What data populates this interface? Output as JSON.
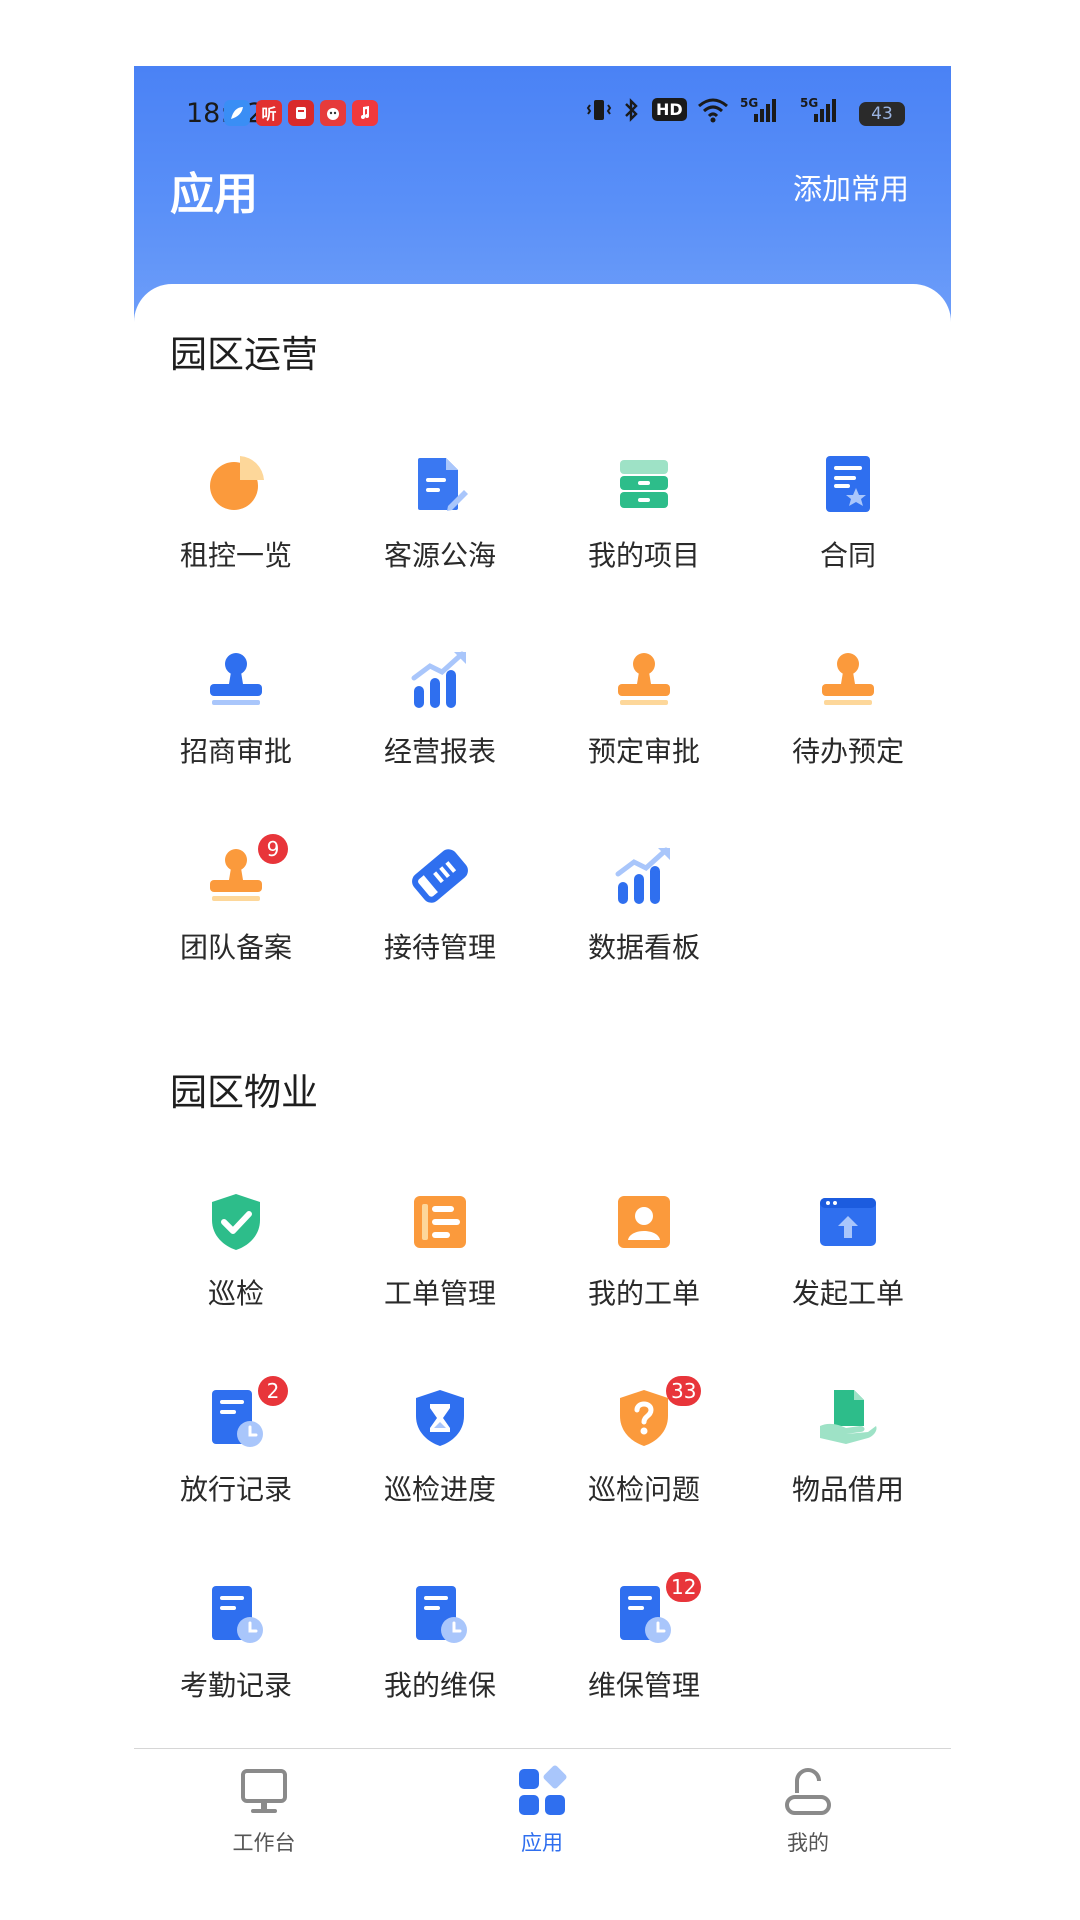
{
  "status_bar": {
    "time": "18:52",
    "notification_icons": [
      "feather-app-icon",
      "ting-app-icon",
      "news-app-icon",
      "mascot-app-icon",
      "music-app-icon"
    ],
    "ting_label": "听",
    "system_icons": [
      "vibrate-icon",
      "bluetooth-icon",
      "hd-icon",
      "wifi-icon",
      "5g-signal-icon",
      "5g-signal-icon"
    ],
    "hd_label": "HD",
    "signal_label": "5G",
    "battery": "43"
  },
  "header": {
    "title": "应用",
    "add_common": "添加常用"
  },
  "sections": [
    {
      "title": "园区运营",
      "apps": [
        {
          "label": "租控一览",
          "icon": "pie-chart-icon"
        },
        {
          "label": "客源公海",
          "icon": "edit-document-icon"
        },
        {
          "label": "我的项目",
          "icon": "archive-box-icon"
        },
        {
          "label": "合同",
          "icon": "contract-star-icon"
        },
        {
          "label": "招商审批",
          "icon": "stamp-blue-icon"
        },
        {
          "label": "经营报表",
          "icon": "bar-chart-trend-icon"
        },
        {
          "label": "预定审批",
          "icon": "stamp-orange-icon"
        },
        {
          "label": "待办预定",
          "icon": "stamp-orange-icon"
        },
        {
          "label": "团队备案",
          "icon": "stamp-orange-icon",
          "badge": "9"
        },
        {
          "label": "接待管理",
          "icon": "ticket-icon"
        },
        {
          "label": "数据看板",
          "icon": "bar-chart-trend-icon"
        }
      ]
    },
    {
      "title": "园区物业",
      "apps": [
        {
          "label": "巡检",
          "icon": "shield-check-icon"
        },
        {
          "label": "工单管理",
          "icon": "work-order-icon"
        },
        {
          "label": "我的工单",
          "icon": "user-card-icon"
        },
        {
          "label": "发起工单",
          "icon": "browser-upload-icon"
        },
        {
          "label": "放行记录",
          "icon": "document-clock-icon",
          "badge": "2"
        },
        {
          "label": "巡检进度",
          "icon": "shield-hourglass-icon"
        },
        {
          "label": "巡检问题",
          "icon": "shield-question-icon",
          "badge": "33"
        },
        {
          "label": "物品借用",
          "icon": "hand-document-icon"
        },
        {
          "label": "考勤记录",
          "icon": "document-clock-icon"
        },
        {
          "label": "我的维保",
          "icon": "document-clock-icon"
        },
        {
          "label": "维保管理",
          "icon": "document-clock-icon",
          "badge": "12"
        }
      ]
    }
  ],
  "tabbar": [
    {
      "label": "工作台",
      "icon": "monitor-icon",
      "active": false
    },
    {
      "label": "应用",
      "icon": "apps-grid-icon",
      "active": true
    },
    {
      "label": "我的",
      "icon": "user-icon",
      "active": false
    }
  ],
  "colors": {
    "header_gradient": [
      "#4a82f5",
      "#6e9ef9"
    ],
    "accent_blue": "#2f6fef",
    "orange": "#fb9a3c",
    "green": "#2dbd8a",
    "badge_red": "#e8353a"
  }
}
